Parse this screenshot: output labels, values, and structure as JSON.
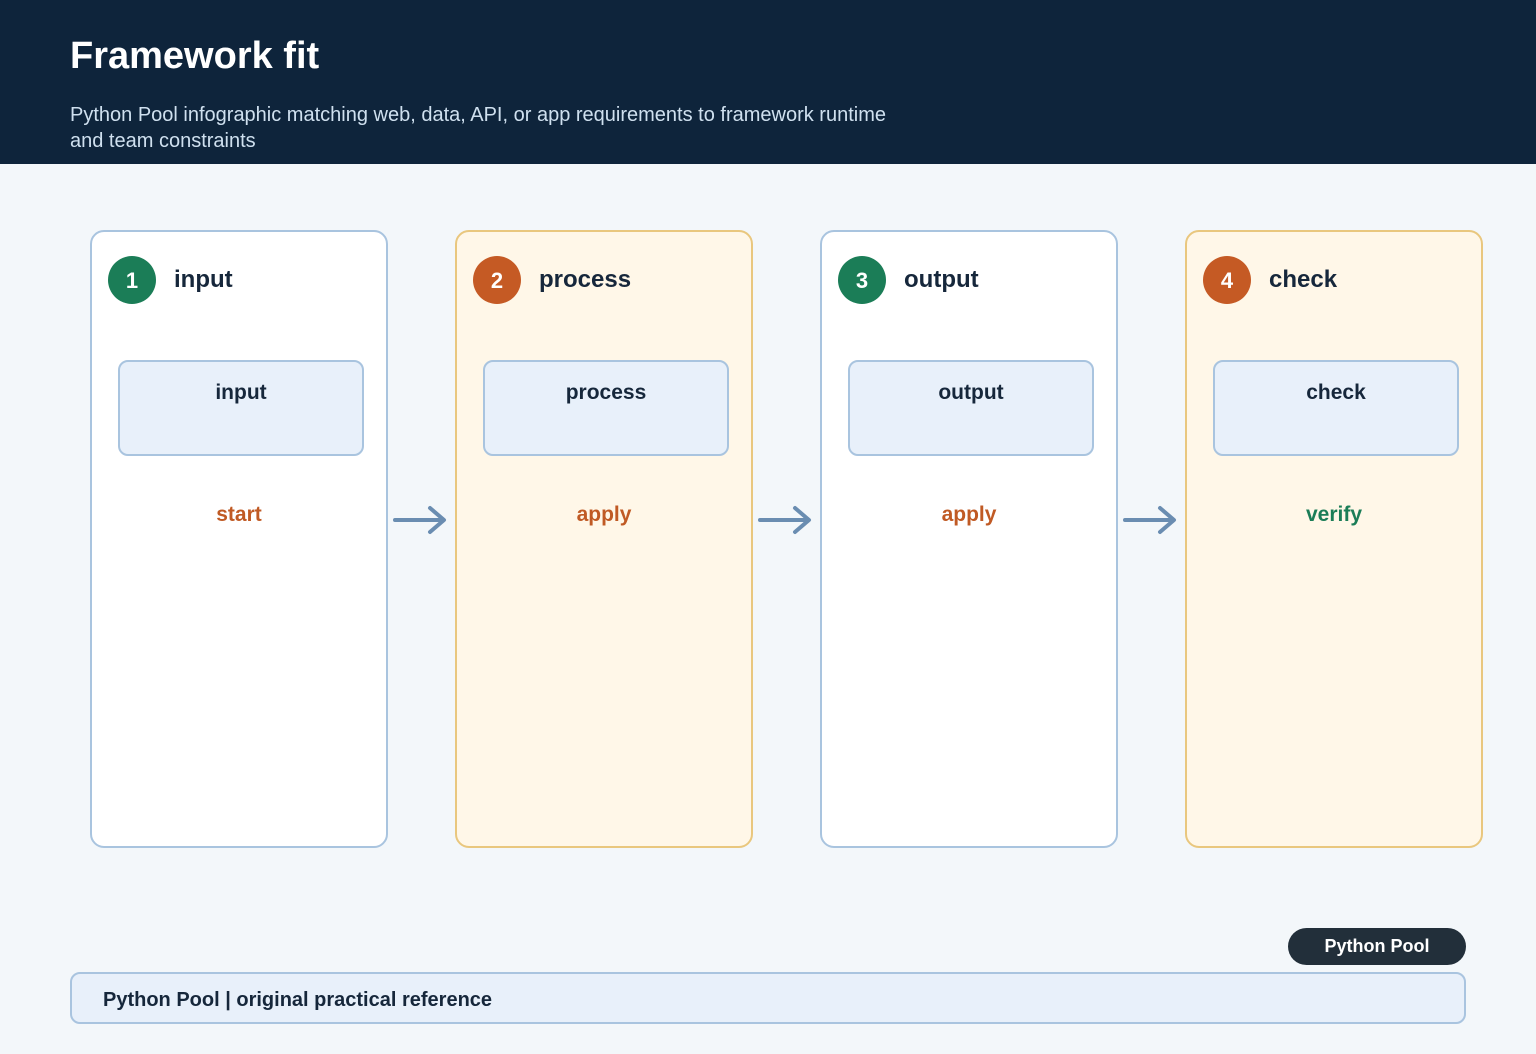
{
  "header": {
    "title": "Framework fit",
    "subtitle": "Python Pool infographic matching web, data, API, or app requirements to framework runtime and team constraints"
  },
  "steps": [
    {
      "number": "1",
      "title": "input",
      "box_label": "input",
      "action": "start",
      "action_color": "#c05a24",
      "number_color": "#1b7d57",
      "style": "plain"
    },
    {
      "number": "2",
      "title": "process",
      "box_label": "process",
      "action": "apply",
      "action_color": "#c05a24",
      "number_color": "#c55a24",
      "style": "highlight"
    },
    {
      "number": "3",
      "title": "output",
      "box_label": "output",
      "action": "apply",
      "action_color": "#c05a24",
      "number_color": "#1b7d57",
      "style": "plain"
    },
    {
      "number": "4",
      "title": "check",
      "box_label": "check",
      "action": "verify",
      "action_color": "#1b7d57",
      "number_color": "#c55a24",
      "style": "highlight"
    }
  ],
  "badge": {
    "label": "Python Pool"
  },
  "footer": {
    "text": "Python Pool | original practical reference"
  },
  "colors": {
    "header_bg": "#0e243b",
    "arrow": "#6a8db1",
    "card_border": "#a9c4df",
    "highlight_bg": "#fff7e8",
    "highlight_border": "#e9c77e"
  }
}
